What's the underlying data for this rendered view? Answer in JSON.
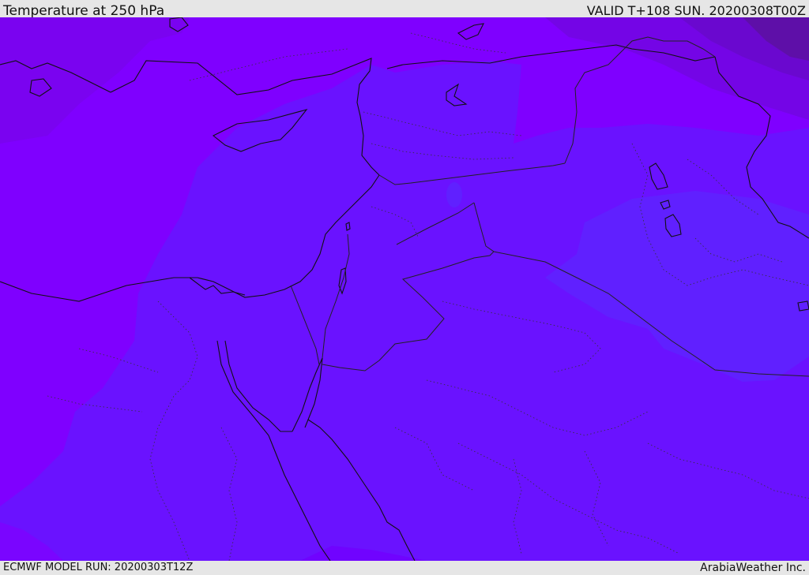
{
  "header": {
    "title": "Temperature at 250 hPa",
    "valid": "VALID T+108 SUN. 20200308T00Z"
  },
  "footer": {
    "model_run": "ECMWF MODEL RUN: 20200303T12Z",
    "credit": "ArabiaWeather Inc."
  },
  "colors": {
    "field_base": "#7f00ff",
    "field_mid": "#6a10ff",
    "field_cold": "#6020ff",
    "field_dark": "#6f06dd",
    "field_darkest": "#5e0fa8",
    "coast_line": "#111111",
    "border_line": "#222222"
  }
}
